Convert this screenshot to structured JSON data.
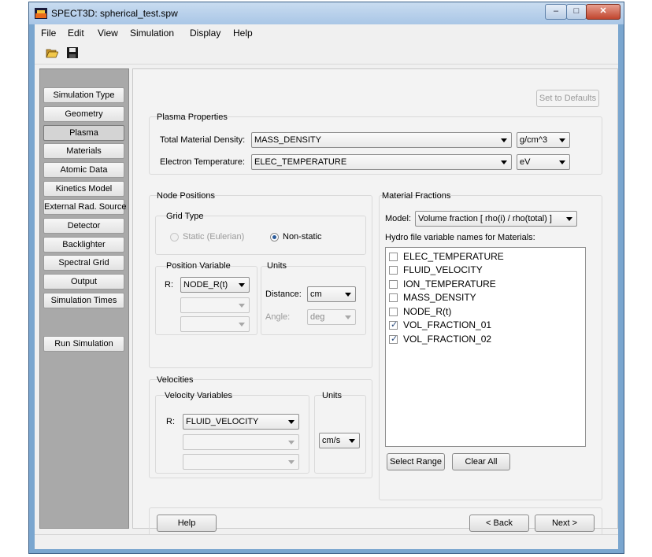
{
  "window": {
    "title": "SPECT3D:  spherical_test.spw",
    "min": "–",
    "max": "□",
    "close": "✕"
  },
  "menu": [
    "File",
    "Edit",
    "View",
    "Simulation",
    "Display",
    "Help"
  ],
  "toolbar": {
    "open": "folder-open-icon",
    "save": "floppy-disk-icon"
  },
  "sidebar": {
    "items": [
      "Simulation Type",
      "Geometry",
      "Plasma",
      "Materials",
      "Atomic Data",
      "Kinetics Model",
      "External Rad. Source",
      "Detector",
      "Backlighter",
      "Spectral Grid",
      "Output",
      "Simulation Times"
    ],
    "active": "Plasma",
    "run": "Run Simulation"
  },
  "main": {
    "defaults_button": "Set to Defaults",
    "plasma": {
      "title": "Plasma Properties",
      "density_label": "Total Material Density:",
      "density_value": "MASS_DENSITY",
      "density_unit": "g/cm^3",
      "temp_label": "Electron Temperature:",
      "temp_value": "ELEC_TEMPERATURE",
      "temp_unit": "eV"
    },
    "node": {
      "title": "Node Positions",
      "grid_title": "Grid Type",
      "static": "Static (Eulerian)",
      "nonstatic": "Non-static",
      "pos_title": "Position Variable",
      "r_label": "R:",
      "r_value": "NODE_R(t)",
      "units_title": "Units",
      "dist_label": "Distance:",
      "dist_value": "cm",
      "angle_label": "Angle:",
      "angle_value": "deg"
    },
    "velocities": {
      "title": "Velocities",
      "var_title": "Velocity Variables",
      "r_label": "R:",
      "r_value": "FLUID_VELOCITY",
      "units_title": "Units",
      "unit_value": "cm/s"
    },
    "materials": {
      "title": "Material Fractions",
      "model_label": "Model:",
      "model_value": "Volume fraction [ rho(i) / rho(total) ]",
      "list_label": "Hydro file variable names for Materials:",
      "items": [
        {
          "name": "ELEC_TEMPERATURE",
          "checked": false
        },
        {
          "name": "FLUID_VELOCITY",
          "checked": false
        },
        {
          "name": "ION_TEMPERATURE",
          "checked": false
        },
        {
          "name": "MASS_DENSITY",
          "checked": false
        },
        {
          "name": "NODE_R(t)",
          "checked": false
        },
        {
          "name": "VOL_FRACTION_01",
          "checked": true
        },
        {
          "name": "VOL_FRACTION_02",
          "checked": true
        }
      ],
      "select_range": "Select Range",
      "clear_all": "Clear All"
    },
    "nav": {
      "help": "Help",
      "back": "< Back",
      "next": "Next >"
    }
  }
}
